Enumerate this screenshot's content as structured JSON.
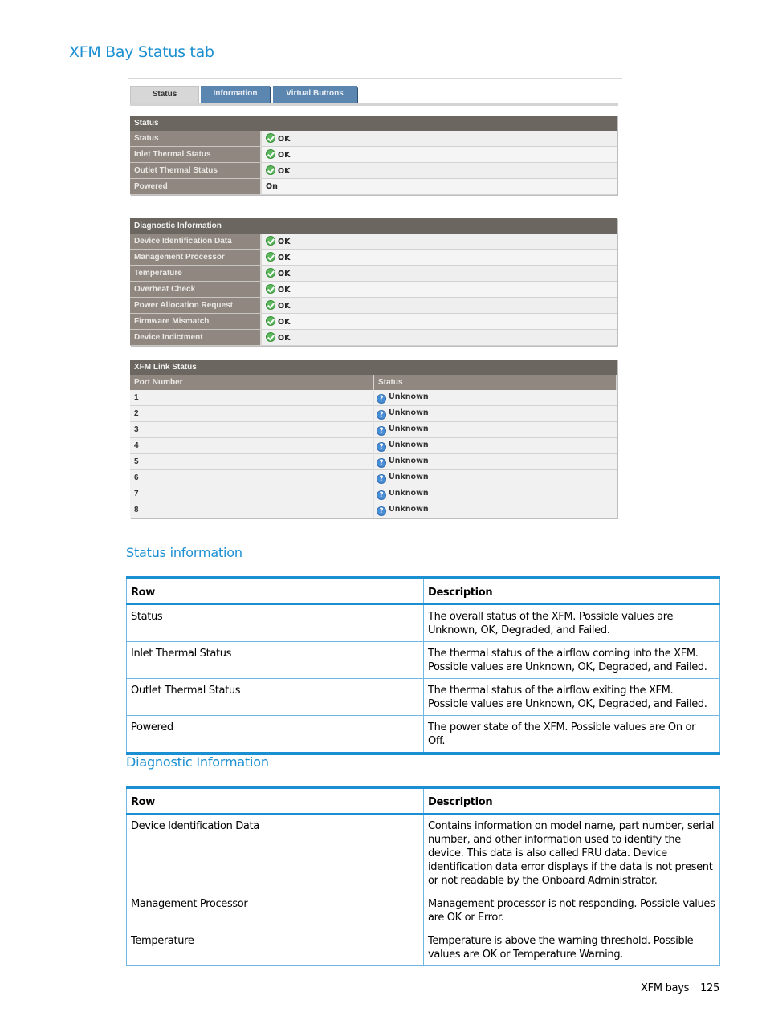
{
  "section_title": "XFM Bay Status tab",
  "screenshot": {
    "tabs": [
      {
        "label": "Status",
        "active": true
      },
      {
        "label": "Information",
        "active": false
      },
      {
        "label": "Virtual Buttons",
        "active": false
      }
    ],
    "status_panel": {
      "title": "Status",
      "rows": [
        {
          "label": "Status",
          "value": "OK",
          "icon": "ok-icon"
        },
        {
          "label": "Inlet Thermal Status",
          "value": "OK",
          "icon": "ok-icon"
        },
        {
          "label": "Outlet Thermal Status",
          "value": "OK",
          "icon": "ok-icon"
        },
        {
          "label": "Powered",
          "value": "On",
          "icon": null
        }
      ]
    },
    "diagnostic_panel": {
      "title": "Diagnostic Information",
      "rows": [
        {
          "label": "Device Identification Data",
          "value": "OK",
          "icon": "ok-icon"
        },
        {
          "label": "Management Processor",
          "value": "OK",
          "icon": "ok-icon"
        },
        {
          "label": "Temperature",
          "value": "OK",
          "icon": "ok-icon"
        },
        {
          "label": "Overheat Check",
          "value": "OK",
          "icon": "ok-icon"
        },
        {
          "label": "Power Allocation Request",
          "value": "OK",
          "icon": "ok-icon"
        },
        {
          "label": "Firmware Mismatch",
          "value": "OK",
          "icon": "ok-icon"
        },
        {
          "label": "Device Indictment",
          "value": "OK",
          "icon": "ok-icon"
        }
      ]
    },
    "link_panel": {
      "title": "XFM Link Status",
      "columns": [
        "Port Number",
        "Status"
      ],
      "rows": [
        {
          "port": "1",
          "status": "Unknown",
          "icon": "unknown-icon"
        },
        {
          "port": "2",
          "status": "Unknown",
          "icon": "unknown-icon"
        },
        {
          "port": "3",
          "status": "Unknown",
          "icon": "unknown-icon"
        },
        {
          "port": "4",
          "status": "Unknown",
          "icon": "unknown-icon"
        },
        {
          "port": "5",
          "status": "Unknown",
          "icon": "unknown-icon"
        },
        {
          "port": "6",
          "status": "Unknown",
          "icon": "unknown-icon"
        },
        {
          "port": "7",
          "status": "Unknown",
          "icon": "unknown-icon"
        },
        {
          "port": "8",
          "status": "Unknown",
          "icon": "unknown-icon"
        }
      ]
    }
  },
  "status_info": {
    "heading": "Status information",
    "columns": [
      "Row",
      "Description"
    ],
    "rows": [
      {
        "row": "Status",
        "description": "The overall status of the XFM. Possible values are Unknown, OK, Degraded, and Failed."
      },
      {
        "row": "Inlet Thermal Status",
        "description": "The thermal status of the airflow coming into the XFM. Possible values are Unknown, OK, Degraded, and Failed."
      },
      {
        "row": "Outlet Thermal Status",
        "description": "The thermal status of the airflow exiting the XFM. Possible values are Unknown, OK, Degraded, and Failed."
      },
      {
        "row": "Powered",
        "description": "The power state of the XFM. Possible values are On or Off."
      }
    ]
  },
  "diagnostic_info": {
    "heading": "Diagnostic Information",
    "columns": [
      "Row",
      "Description"
    ],
    "rows": [
      {
        "row": "Device Identification Data",
        "description": "Contains information on model name, part number, serial number, and other information used to identify the device. This data is also called FRU data. Device identification data error displays if the data is not present or not readable by the Onboard Administrator."
      },
      {
        "row": "Management Processor",
        "description": "Management processor is not responding. Possible values are OK or Error."
      },
      {
        "row": "Temperature",
        "description": "Temperature is above the warning threshold. Possible values are OK or Temperature Warning."
      }
    ]
  },
  "footer": {
    "section": "XFM bays",
    "page": "125"
  },
  "colors": {
    "accent": "#1a8fd1",
    "panel_header": "#6b665f",
    "panel_label": "#8f8780",
    "tab_inactive": "#5b86b0",
    "ok_green": "#5cb85c",
    "unknown_blue": "#4a8fd6"
  }
}
